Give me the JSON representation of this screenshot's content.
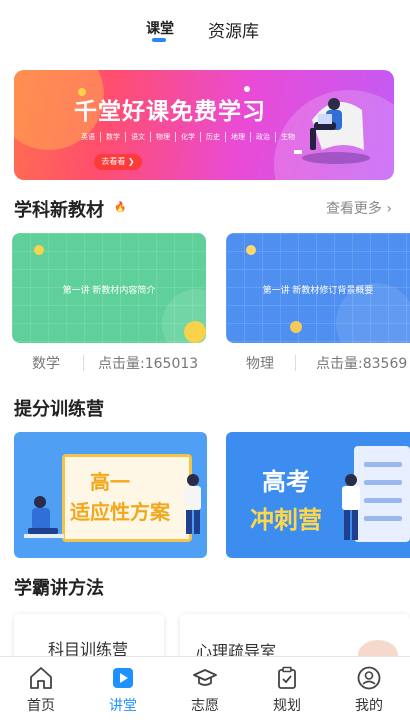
{
  "top_tabs": {
    "active": "课堂",
    "other": "资源库"
  },
  "banner": {
    "title": "千堂好课免费学习",
    "subjects": [
      "英语",
      "数学",
      "语文",
      "物理",
      "化学",
      "历史",
      "地理",
      "政治",
      "生物"
    ],
    "button": "去看看 ❯"
  },
  "section_textbook": {
    "title": "学科新教材",
    "more": "查看更多 ›"
  },
  "courses": [
    {
      "card_text": "第一讲 新教材内容简介",
      "subject": "数学",
      "clicks": "点击量:165013",
      "color": "#5fd09a"
    },
    {
      "card_text": "第一讲 新教材修订背景概要",
      "subject": "物理",
      "clicks": "点击量:83569",
      "color": "#4f8ff0"
    }
  ],
  "section_camp": {
    "title": "提分训练营"
  },
  "camps": [
    {
      "line1": "高一",
      "line2": "适应性方案"
    },
    {
      "line1": "高考",
      "line2": "冲刺营"
    }
  ],
  "section_method": {
    "title": "学霸讲方法"
  },
  "methods": [
    {
      "label": "科目训练营"
    },
    {
      "label": "心理疏导室"
    }
  ],
  "nav": {
    "active": "讲堂",
    "items": [
      {
        "label": "首页",
        "icon": "home-icon"
      },
      {
        "label": "讲堂",
        "icon": "video-play-icon"
      },
      {
        "label": "志愿",
        "icon": "graduation-cap-icon"
      },
      {
        "label": "规划",
        "icon": "clipboard-check-icon"
      },
      {
        "label": "我的",
        "icon": "user-profile-icon"
      }
    ],
    "colors": {
      "active": "#1e90ff",
      "inactive": "#333333"
    }
  }
}
